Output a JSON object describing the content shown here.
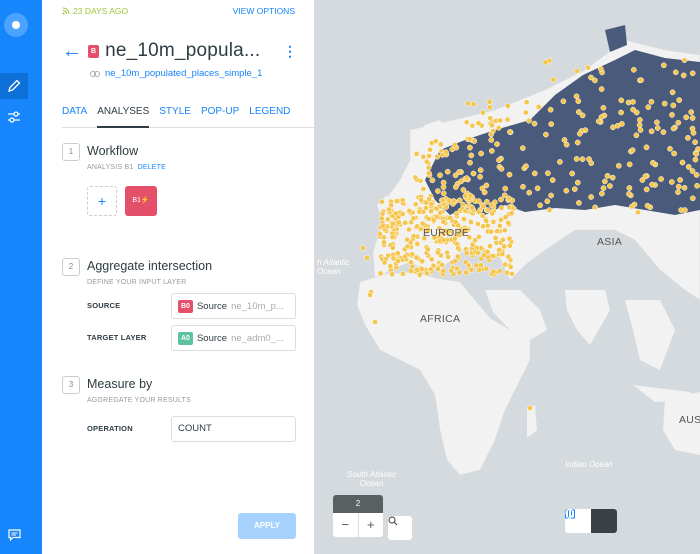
{
  "sidebar": {
    "items": [
      {
        "icon": "pencil-icon",
        "active": true
      },
      {
        "icon": "sliders-icon",
        "active": false
      },
      {
        "icon": "chat-icon",
        "active": false
      }
    ]
  },
  "panel": {
    "updated": "23 DAYS AGO",
    "view_options": "VIEW OPTIONS",
    "layer_badge": "B",
    "layer_title": "ne_10m_popula...",
    "layer_source": "ne_10m_populated_places_simple_1",
    "tabs": [
      {
        "label": "DATA",
        "active": false
      },
      {
        "label": "ANALYSES",
        "active": true
      },
      {
        "label": "STYLE",
        "active": false
      },
      {
        "label": "POP-UP",
        "active": false
      },
      {
        "label": "LEGEND",
        "active": false
      }
    ],
    "workflow": {
      "num": "1",
      "title": "Workflow",
      "subtitle": "ANALYSIS B1",
      "delete": "DELETE",
      "add": "+",
      "node": "B1"
    },
    "aggregate": {
      "num": "2",
      "title": "Aggregate intersection",
      "subtitle": "DEFINE YOUR INPUT LAYER",
      "source_label": "SOURCE",
      "source_badge": "B0",
      "source_value": "Source",
      "source_name": "ne_10m_p...",
      "target_label": "TARGET LAYER",
      "target_badge": "A0",
      "target_value": "Source",
      "target_name": "ne_adm0_..."
    },
    "measure": {
      "num": "3",
      "title": "Measure by",
      "subtitle": "AGGREGATE YOUR RESULTS",
      "operation_label": "OPERATION",
      "operation_value": "COUNT"
    },
    "apply": "APPLY"
  },
  "map": {
    "labels": {
      "europe": "EUROPE",
      "asia": "ASIA",
      "africa": "AFRICA",
      "aus": "AUS"
    },
    "oceans": {
      "north_atlantic_1": "h Atlantic",
      "north_atlantic_2": "Ocean",
      "south_atlantic_1": "South Atlantic",
      "south_atlantic_2": "Ocean",
      "indian": "Indian Ocean"
    },
    "zoom_level": "2",
    "zoom_out": "−",
    "zoom_in": "+",
    "colors": {
      "points": "#f5c64d",
      "highlight_region": "#4a5a7a",
      "land": "#f2f2f2",
      "water": "#d4dadd"
    }
  }
}
